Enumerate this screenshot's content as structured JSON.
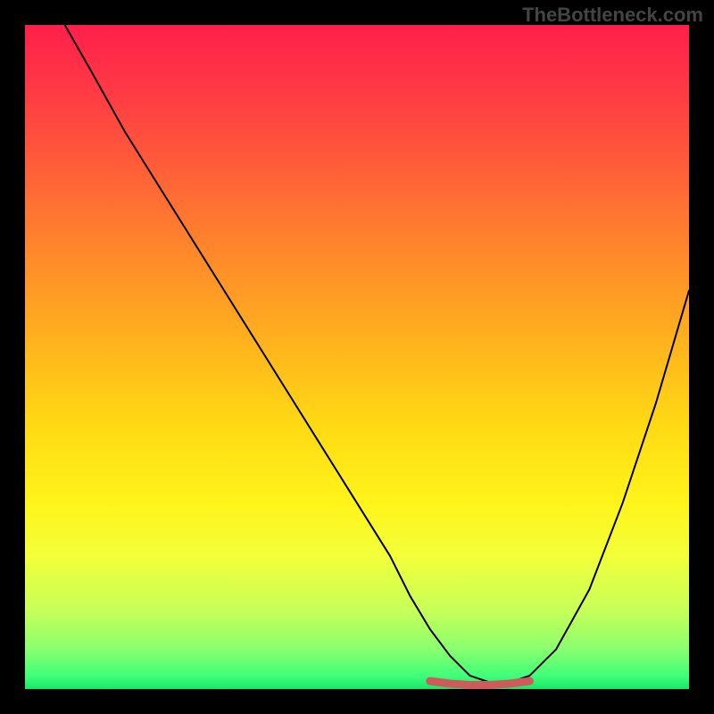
{
  "watermark": "TheBottleneck.com",
  "chart_data": {
    "type": "line",
    "title": "",
    "xlabel": "",
    "ylabel": "",
    "xlim": [
      0,
      100
    ],
    "ylim": [
      0,
      100
    ],
    "background_gradient": {
      "top": "#ff1f4b",
      "middle": "#ffd914",
      "bottom": "#17e86a"
    },
    "series": [
      {
        "name": "black-curve",
        "color": "#000000",
        "width": 2,
        "x": [
          6,
          10,
          15,
          20,
          25,
          30,
          35,
          40,
          45,
          50,
          55,
          58,
          61,
          64,
          67,
          70,
          73,
          76,
          80,
          85,
          90,
          95,
          100
        ],
        "y": [
          100,
          93,
          84,
          76,
          68,
          60,
          52,
          44,
          36,
          28,
          20,
          14,
          9,
          5,
          2,
          1,
          1,
          2,
          6,
          15,
          28,
          43,
          60
        ]
      },
      {
        "name": "red-flat-segment",
        "color": "#ce5b5b",
        "width": 9,
        "x": [
          61,
          64,
          67,
          70,
          73,
          76
        ],
        "y": [
          1.2,
          0.8,
          0.6,
          0.6,
          0.8,
          1.2
        ]
      }
    ]
  }
}
